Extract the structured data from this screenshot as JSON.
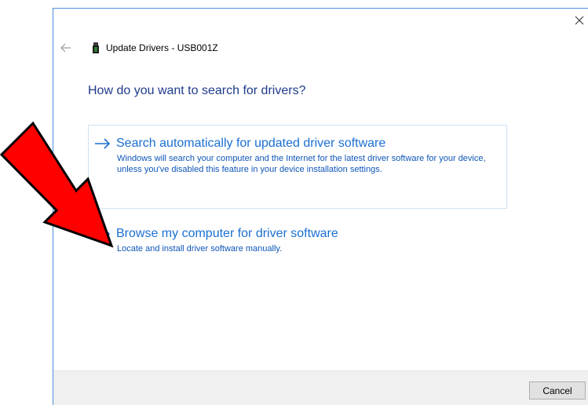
{
  "window": {
    "title": "Update Drivers - USB001Z",
    "close_icon": "close-icon",
    "back_icon": "back-arrow-icon",
    "device_icon": "usb-device-icon"
  },
  "main": {
    "heading": "How do you want to search for drivers?",
    "options": [
      {
        "title": "Search automatically for updated driver software",
        "description": "Windows will search your computer and the Internet for the latest driver software for your device, unless you've disabled this feature in your device installation settings.",
        "icon": "arrow-right-icon"
      },
      {
        "title": "Browse my computer for driver software",
        "description": "Locate and install driver software manually.",
        "icon": "arrow-right-icon"
      }
    ]
  },
  "footer": {
    "cancel_label": "Cancel"
  },
  "annotation": {
    "icon": "red-pointer-arrow",
    "color": "#ff0000"
  },
  "colors": {
    "accent": "#1b6fd1",
    "heading": "#1f3b8c",
    "footer_bg": "#f0f0f0"
  }
}
